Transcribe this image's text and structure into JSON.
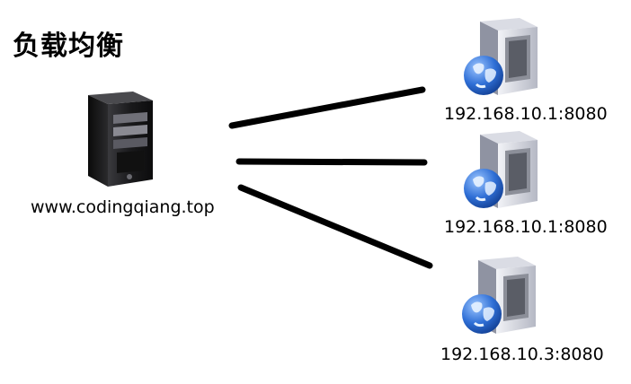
{
  "title": "负载均衡",
  "load_balancer": {
    "label": "www.codingqiang.top",
    "icon": "tower-server-icon"
  },
  "servers": [
    {
      "label": "192.168.10.1:8080",
      "icon": "globe-server-icon"
    },
    {
      "label": "192.168.10.1:8080",
      "icon": "globe-server-icon"
    },
    {
      "label": "192.168.10.3:8080",
      "icon": "globe-server-icon"
    }
  ],
  "colors": {
    "connector": "#000000",
    "globe": "#2f6fd6",
    "server_body": "#c9cbd4",
    "tower_body": "#1d1d1f"
  }
}
